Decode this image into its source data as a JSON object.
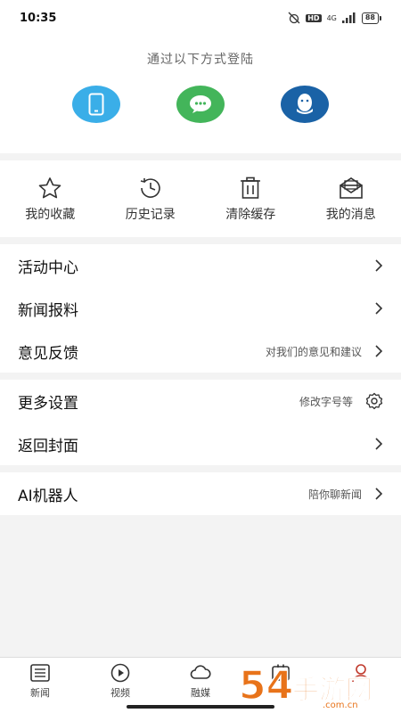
{
  "status": {
    "time": "10:35",
    "network": "4G",
    "hd": "HD",
    "battery": "88"
  },
  "login": {
    "title": "通过以下方式登陆",
    "methods": [
      {
        "icon": "phone-icon"
      },
      {
        "icon": "wechat-icon"
      },
      {
        "icon": "qq-icon"
      }
    ]
  },
  "quick": [
    {
      "label": "我的收藏",
      "icon": "star-icon"
    },
    {
      "label": "历史记录",
      "icon": "history-icon"
    },
    {
      "label": "清除缓存",
      "icon": "trash-icon"
    },
    {
      "label": "我的消息",
      "icon": "mail-icon"
    }
  ],
  "menu1": [
    {
      "label": "活动中心",
      "hint": ""
    },
    {
      "label": "新闻报料",
      "hint": ""
    },
    {
      "label": "意见反馈",
      "hint": "对我们的意见和建议"
    }
  ],
  "menu2": [
    {
      "label": "更多设置",
      "hint": "修改字号等"
    },
    {
      "label": "返回封面",
      "hint": ""
    }
  ],
  "menu3": [
    {
      "label": "AI机器人",
      "hint": "陪你聊新闻"
    }
  ],
  "tabs": [
    {
      "label": "新闻",
      "icon": "news-icon"
    },
    {
      "label": "视频",
      "icon": "video-icon"
    },
    {
      "label": "融媒",
      "icon": "cloud-icon"
    },
    {
      "label": "",
      "icon": "service-icon"
    },
    {
      "label": "",
      "icon": "profile-icon"
    }
  ],
  "watermark": {
    "text1": "54",
    "text2": "手游网",
    "text3": ".com.cn"
  },
  "colors": {
    "phone": "#3aaee8",
    "wechat": "#43b55a",
    "qq": "#1a62a6",
    "watermark": "#e8731a"
  }
}
